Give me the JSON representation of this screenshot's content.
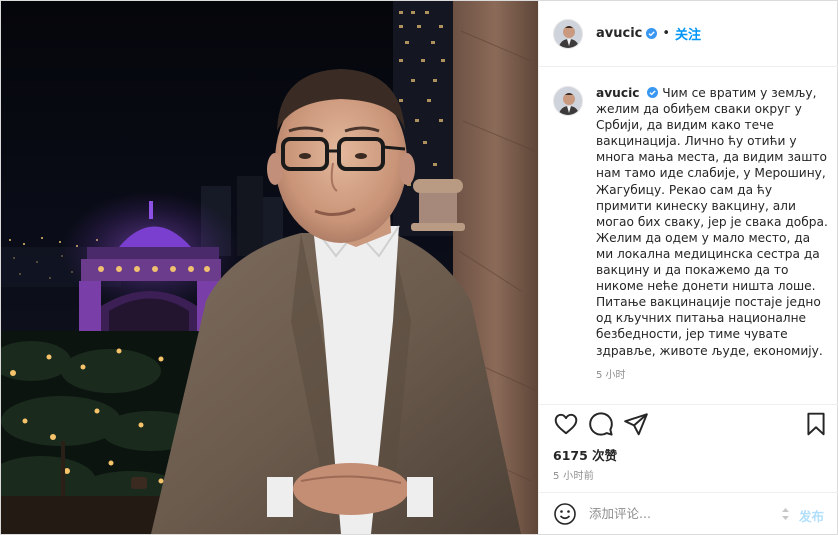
{
  "post": {
    "username": "avucic",
    "follow_label": "关注",
    "caption": "Чим се вратим у земљу, желим да обиђем сваки округ у Србији, да видим како тече вакцинација. Лично ћу отићи у многа мања места, да видим зашто нам тамо иде слабије, у Мерошину, Жагубицу. Рекао сам да ћу примити кинеску вакцину, али могао бих сваку, јер је свака добра. Желим да одем у мало место, да ми локална медицинска сестра да вакцину и да покажемо да то никоме неће донети ништа лоше. Питање вакцинације постаје једно од кључних питања националне безбедности, јер тиме чувате здравље, животе људе, економију.",
    "caption_time": "5 小时",
    "likes": "6175 次赞",
    "post_time": "5 小时前"
  },
  "comment": {
    "placeholder": "添加评论...",
    "post_label": "发布"
  },
  "icons": {
    "verified": "verified-badge-icon",
    "like": "heart-icon",
    "comment": "comment-bubble-icon",
    "share": "paper-plane-icon",
    "save": "bookmark-icon",
    "emoji": "smiley-icon"
  },
  "colors": {
    "accent": "#0095f6",
    "verified": "#3897f0",
    "muted": "#8e8e8e",
    "post_disabled": "#b2dffc"
  }
}
